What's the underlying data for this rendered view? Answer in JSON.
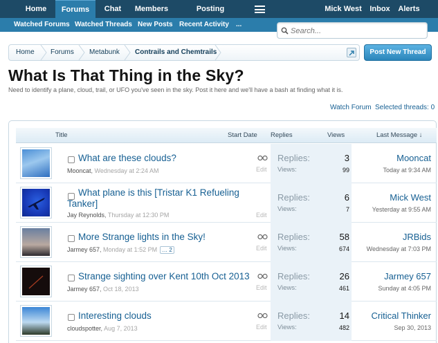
{
  "nav": {
    "tabs": [
      "Home",
      "Forums",
      "Chat",
      "Members",
      "Posting Guidelines"
    ],
    "user": "Mick West",
    "inbox": "Inbox",
    "alerts": "Alerts"
  },
  "subnav": {
    "items": [
      "Watched Forums",
      "Watched Threads",
      "New Posts",
      "Recent Activity",
      "..."
    ]
  },
  "search": {
    "placeholder": "Search..."
  },
  "breadcrumb": [
    "Home",
    "Forums",
    "Metabunk",
    "Contrails and Chemtrails"
  ],
  "post_button": "Post New Thread",
  "page": {
    "title": "What Is That Thing in the Sky?",
    "description": "Need to identify a plane, cloud, trail, or UFO you've seen in the sky. Post it here and we'll have a bash at finding what it is."
  },
  "actions": {
    "watch": "Watch Forum",
    "selected": "Selected threads: 0"
  },
  "columns": {
    "title": "Title",
    "start_date": "Start Date",
    "replies": "Replies",
    "views": "Views",
    "last": "Last Message ↓"
  },
  "labels": {
    "replies": "Replies:",
    "views": "Views:",
    "edit": "Edit"
  },
  "threads": [
    {
      "title": "What are these clouds?",
      "author": "Mooncat",
      "date": "Wednesday at 2:24 AM",
      "replies": "3",
      "views": "99",
      "last_user": "Mooncat",
      "last_date": "Today at 9:34 AM"
    },
    {
      "title": "What plane is this [Tristar K1 Refueling Tanker]",
      "author": "Jay Reynolds",
      "date": "Thursday at 12:30 PM",
      "replies": "6",
      "views": "7",
      "last_user": "Mick West",
      "last_date": "Yesterday at 9:55 AM"
    },
    {
      "title": "More Strange lights in the Sky!",
      "author": "Jarmey 657",
      "date": "Monday at 1:52 PM",
      "pages": "… 2",
      "replies": "58",
      "views": "674",
      "last_user": "JRBids",
      "last_date": "Wednesday at 7:03 PM"
    },
    {
      "title": "Strange sighting over Kent 10th Oct 2013",
      "author": "Jarmey 657",
      "date": "Oct 18, 2013",
      "replies": "26",
      "views": "461",
      "last_user": "Jarmey 657",
      "last_date": "Sunday at 4:05 PM"
    },
    {
      "title": "Interesting clouds",
      "author": "cloudspotter",
      "date": "Aug 7, 2013",
      "replies": "14",
      "views": "482",
      "last_user": "Critical Thinker",
      "last_date": "Sep 30, 2013"
    }
  ]
}
